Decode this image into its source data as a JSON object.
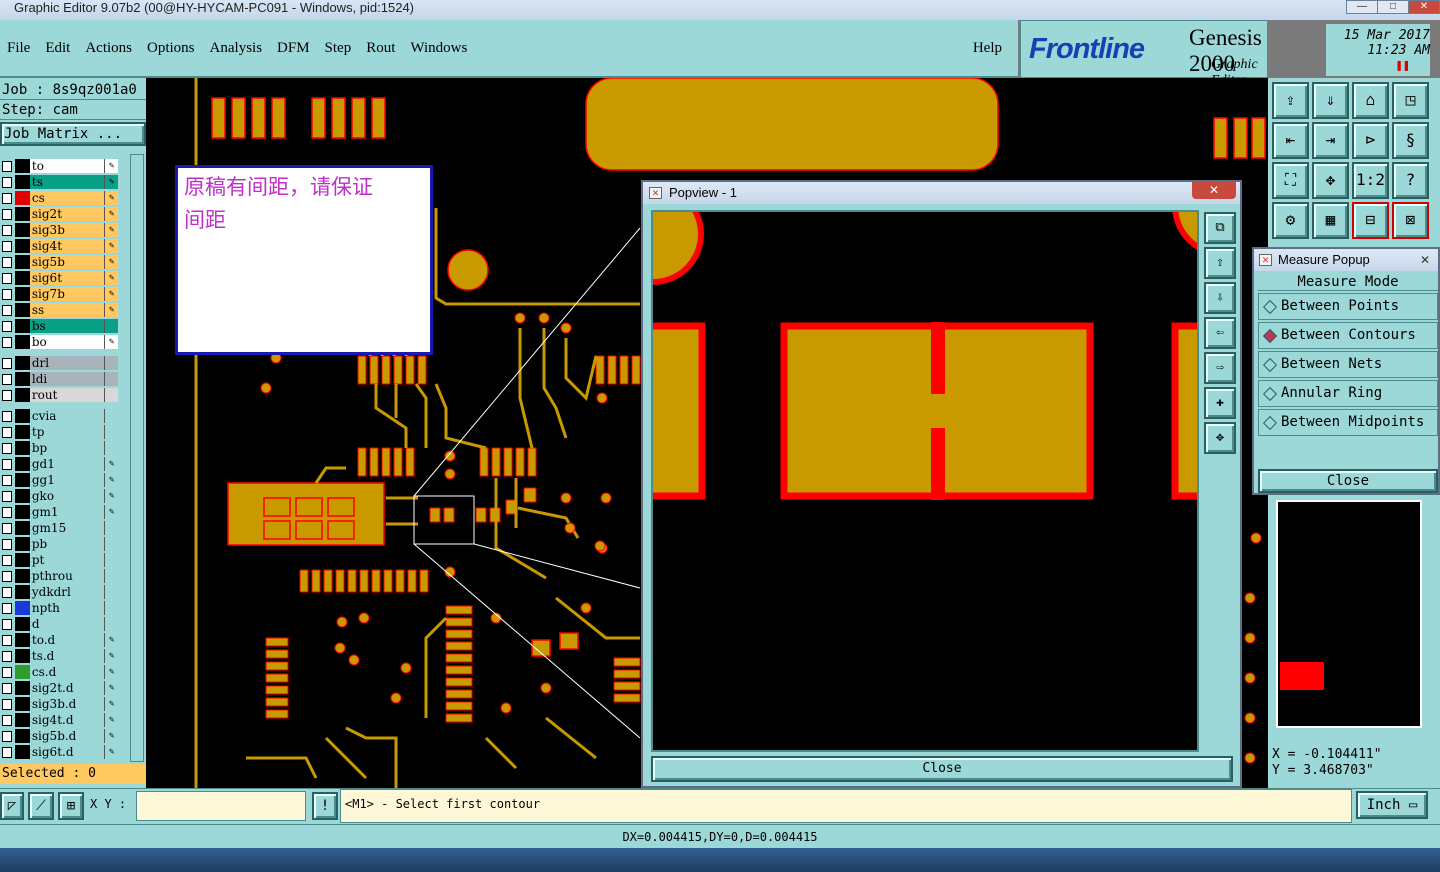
{
  "window": {
    "title": "Graphic Editor 9.07b2 (00@HY-HYCAM-PC091 - Windows, pid:1524)"
  },
  "menu": {
    "items": [
      "File",
      "Edit",
      "Actions",
      "Options",
      "Analysis",
      "DFM",
      "Step",
      "Rout",
      "Windows"
    ],
    "help": "Help"
  },
  "branding": {
    "logo": "Frontline",
    "product": "Genesis 2000",
    "module": "Graphic Editor",
    "date": "15 Mar 2017",
    "time": "11:23 AM"
  },
  "job": {
    "job_line": "Job : 8s9qz001a0",
    "step_line": "Step: cam",
    "matrix_button": "Job Matrix ..."
  },
  "layers": {
    "group1": [
      {
        "name": "to",
        "color": "#ffffff",
        "swatch": "#000000",
        "edit": true
      },
      {
        "name": "ts",
        "color": "#0aa088",
        "swatch": "#000000",
        "edit": true
      },
      {
        "name": "cs",
        "color": "#ffc860",
        "swatch": "#e00000",
        "edit": true
      },
      {
        "name": "sig2t",
        "color": "#ffc860",
        "swatch": "#000000",
        "edit": true
      },
      {
        "name": "sig3b",
        "color": "#ffc860",
        "swatch": "#000000",
        "edit": true
      },
      {
        "name": "sig4t",
        "color": "#ffc860",
        "swatch": "#000000",
        "edit": true
      },
      {
        "name": "sig5b",
        "color": "#ffc860",
        "swatch": "#000000",
        "edit": true
      },
      {
        "name": "sig6t",
        "color": "#ffc860",
        "swatch": "#000000",
        "edit": true
      },
      {
        "name": "sig7b",
        "color": "#ffc860",
        "swatch": "#000000",
        "edit": true
      },
      {
        "name": "ss",
        "color": "#ffc860",
        "swatch": "#000000",
        "edit": true
      },
      {
        "name": "bs",
        "color": "#0aa088",
        "swatch": "#000000",
        "edit": false
      },
      {
        "name": "bo",
        "color": "#ffffff",
        "swatch": "#000000",
        "edit": true
      }
    ],
    "group2": [
      {
        "name": "drl",
        "color": "#a8b4bc",
        "swatch": "#000000",
        "edit": false
      },
      {
        "name": "ldi",
        "color": "#a8b4bc",
        "swatch": "#000000",
        "edit": false
      },
      {
        "name": "rout",
        "color": "#d8d8d8",
        "swatch": "#000000",
        "edit": false
      }
    ],
    "group3": [
      {
        "name": "cvia",
        "color": "#9cd8d8",
        "swatch": "#000000",
        "edit": false
      },
      {
        "name": "tp",
        "color": "#9cd8d8",
        "swatch": "#000000",
        "edit": false
      },
      {
        "name": "bp",
        "color": "#9cd8d8",
        "swatch": "#000000",
        "edit": false
      },
      {
        "name": "gd1",
        "color": "#9cd8d8",
        "swatch": "#000000",
        "edit": true
      },
      {
        "name": "gg1",
        "color": "#9cd8d8",
        "swatch": "#000000",
        "edit": true
      },
      {
        "name": "gko",
        "color": "#9cd8d8",
        "swatch": "#000000",
        "edit": true
      },
      {
        "name": "gm1",
        "color": "#9cd8d8",
        "swatch": "#000000",
        "edit": true
      },
      {
        "name": "gm15",
        "color": "#9cd8d8",
        "swatch": "#000000",
        "edit": false
      },
      {
        "name": "pb",
        "color": "#9cd8d8",
        "swatch": "#000000",
        "edit": false
      },
      {
        "name": "pt",
        "color": "#9cd8d8",
        "swatch": "#000000",
        "edit": false
      },
      {
        "name": "pthrou",
        "color": "#9cd8d8",
        "swatch": "#000000",
        "edit": false
      },
      {
        "name": "ydkdrl",
        "color": "#9cd8d8",
        "swatch": "#000000",
        "edit": false
      },
      {
        "name": "npth",
        "color": "#9cd8d8",
        "swatch": "#1a3ad8",
        "edit": false
      },
      {
        "name": "d",
        "color": "#9cd8d8",
        "swatch": "#000000",
        "edit": false
      },
      {
        "name": "to.d",
        "color": "#9cd8d8",
        "swatch": "#000000",
        "edit": true
      },
      {
        "name": "ts.d",
        "color": "#9cd8d8",
        "swatch": "#000000",
        "edit": true
      },
      {
        "name": "cs.d",
        "color": "#9cd8d8",
        "swatch": "#2e9c2e",
        "edit": true
      },
      {
        "name": "sig2t.d",
        "color": "#9cd8d8",
        "swatch": "#000000",
        "edit": true
      },
      {
        "name": "sig3b.d",
        "color": "#9cd8d8",
        "swatch": "#000000",
        "edit": true
      },
      {
        "name": "sig4t.d",
        "color": "#9cd8d8",
        "swatch": "#000000",
        "edit": true
      },
      {
        "name": "sig5b.d",
        "color": "#9cd8d8",
        "swatch": "#000000",
        "edit": true
      },
      {
        "name": "sig6t.d",
        "color": "#9cd8d8",
        "swatch": "#000000",
        "edit": true
      }
    ],
    "selected": "Selected : 0"
  },
  "note": {
    "text_line1": "原稿有间距，请保证",
    "text_line2": "间距"
  },
  "popview": {
    "title": "Popview - 1",
    "close": "Close"
  },
  "measure_popup": {
    "title": "Measure Popup",
    "header": "Measure Mode",
    "options": [
      "Between Points",
      "Between Contours",
      "Between Nets",
      "Annular Ring",
      "Between Midpoints"
    ],
    "selected_index": 1,
    "close": "Close"
  },
  "coords": {
    "x": "X = -0.104411\"",
    "y": "Y = 3.468703\""
  },
  "status": {
    "xy_label": "X Y :",
    "xy_value": "",
    "message": "<M1> - Select first contour",
    "units": "Inch",
    "dx_line": "DX=0.004415,DY=0,D=0.004415"
  },
  "colors": {
    "panel": "#9cd8d8",
    "copper": "#c89a00",
    "outline": "#ff0000",
    "canvas": "#000000"
  }
}
